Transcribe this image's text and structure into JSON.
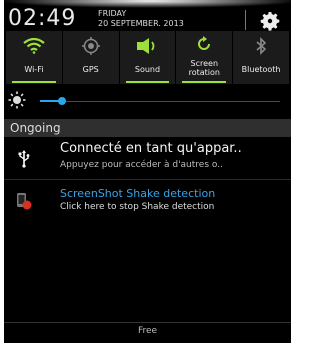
{
  "status": {
    "time": "02:49",
    "day": "FRIDAY",
    "date": "20 SEPTEMBER. 2013"
  },
  "quick_settings": [
    {
      "label": "Wi-Fi",
      "active": true,
      "icon": "wifi-icon"
    },
    {
      "label": "GPS",
      "active": false,
      "icon": "gps-icon"
    },
    {
      "label": "Sound",
      "active": true,
      "icon": "sound-icon"
    },
    {
      "label": "Screen rotation",
      "active": true,
      "icon": "rotation-icon"
    },
    {
      "label": "Bluetooth",
      "active": false,
      "icon": "bluetooth-icon"
    }
  ],
  "brightness": {
    "level": 0.05,
    "accent": "#2aa7ea"
  },
  "section": {
    "ongoing": "Ongoing"
  },
  "notifications": [
    {
      "title": "Connecté en tant qu'appar..",
      "text": "Appuyez pour accéder à d'autres o..",
      "icon": "usb-icon"
    },
    {
      "title": "ScreenShot Shake detection",
      "text": "Click here to stop Shake detection",
      "icon": "app-icon"
    }
  ],
  "footer": {
    "text": "Free"
  },
  "colors": {
    "active_toggle": "#9ee03a",
    "accent_blue": "#3aa3e6"
  }
}
